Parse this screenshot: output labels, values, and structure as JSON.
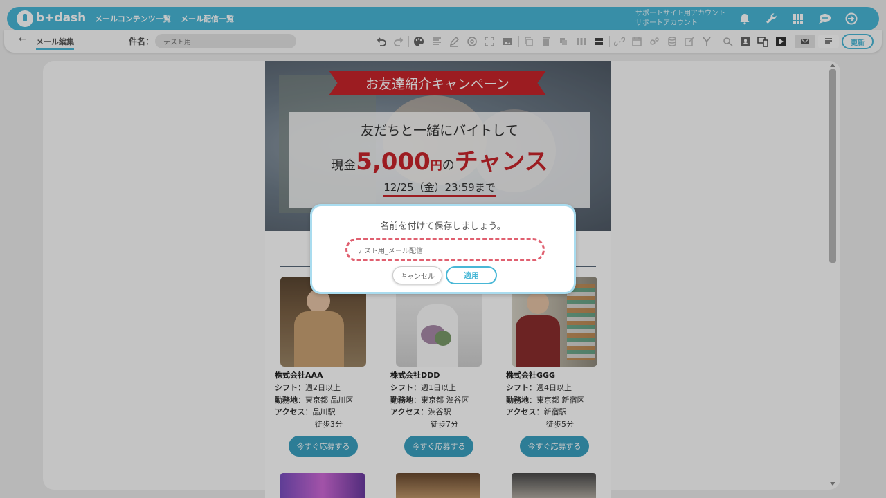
{
  "header": {
    "logo_text": "b+dash",
    "nav": [
      "メールコンテンツ一覧",
      "メール配信一覧"
    ],
    "account_line1": "サポートサイト用アカウント",
    "account_line2": "サポートアカウント",
    "icons": [
      "bell-icon",
      "wrench-icon",
      "apps-grid-icon",
      "chat-icon",
      "logout-icon"
    ]
  },
  "toolbar": {
    "back_label": "メール編集",
    "subject_label": "件名：",
    "subject_value": "テスト用",
    "update_label": "更新"
  },
  "email": {
    "ribbon": "お友達紹介キャンペーン",
    "headline1": "友だちと一緒にバイトして",
    "headline2_prefix": "現金",
    "headline2_amount": "5,000",
    "headline2_unit": "円",
    "headline2_no": "の",
    "headline2_chance": "チャンス",
    "deadline": "12/25（金）23:59まで",
    "cards": [
      {
        "company": "株式会社AAA",
        "shift_label": "シフト",
        "shift": "：週2日以上",
        "place_label": "勤務地",
        "place": "：東京都 品川区",
        "access_label": "アクセス",
        "access": "：品川駅",
        "walk": "徒歩3分",
        "button": "今すぐ応募する"
      },
      {
        "company": "株式会社DDD",
        "shift_label": "シフト",
        "shift": "：週1日以上",
        "place_label": "勤務地",
        "place": "：東京都 渋谷区",
        "access_label": "アクセス",
        "access": "：渋谷駅",
        "walk": "徒歩7分",
        "button": "今すぐ応募する"
      },
      {
        "company": "株式会社GGG",
        "shift_label": "シフト",
        "shift": "：週4日以上",
        "place_label": "勤務地",
        "place": "：東京都 新宿区",
        "access_label": "アクセス",
        "access": "：新宿駅",
        "walk": "徒歩5分",
        "button": "今すぐ応募する"
      }
    ]
  },
  "modal": {
    "title": "名前を付けて保存しましょう。",
    "input_value": "テスト用_メール配信",
    "cancel": "キャンセル",
    "apply": "適用"
  },
  "colors": {
    "brand": "#48b7d6",
    "accent_red": "#c8252b",
    "button_teal": "#3aa0c0",
    "modal_dashed": "#e06070"
  }
}
